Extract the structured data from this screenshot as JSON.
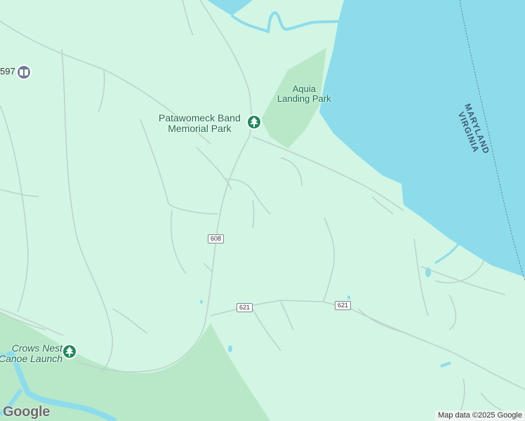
{
  "map": {
    "colors": {
      "land": "#d2f5e4",
      "water": "#8cdcec",
      "park": "#b8e8c8",
      "road": "#bcd3c8",
      "poi_green": "#1e8a5b"
    },
    "pois": [
      {
        "label_line1": "Patawomeck Band",
        "label_line2": "Memorial Park",
        "icon": "tree-icon"
      },
      {
        "label_line1": "Crows Nest",
        "label_line2": "Canoe Launch",
        "icon": "tree-icon"
      },
      {
        "icon": "book-icon"
      }
    ],
    "parks": [
      {
        "label_line1": "Aquia",
        "label_line2": "Landing Park"
      }
    ],
    "route_shields": [
      "608",
      "621",
      "621"
    ],
    "partial_route_number": "597",
    "state_border": {
      "line1": "MARYLAND",
      "line2": "VIRGINIA"
    },
    "logo": "Google",
    "attribution": "Map data ©2025 Google"
  }
}
